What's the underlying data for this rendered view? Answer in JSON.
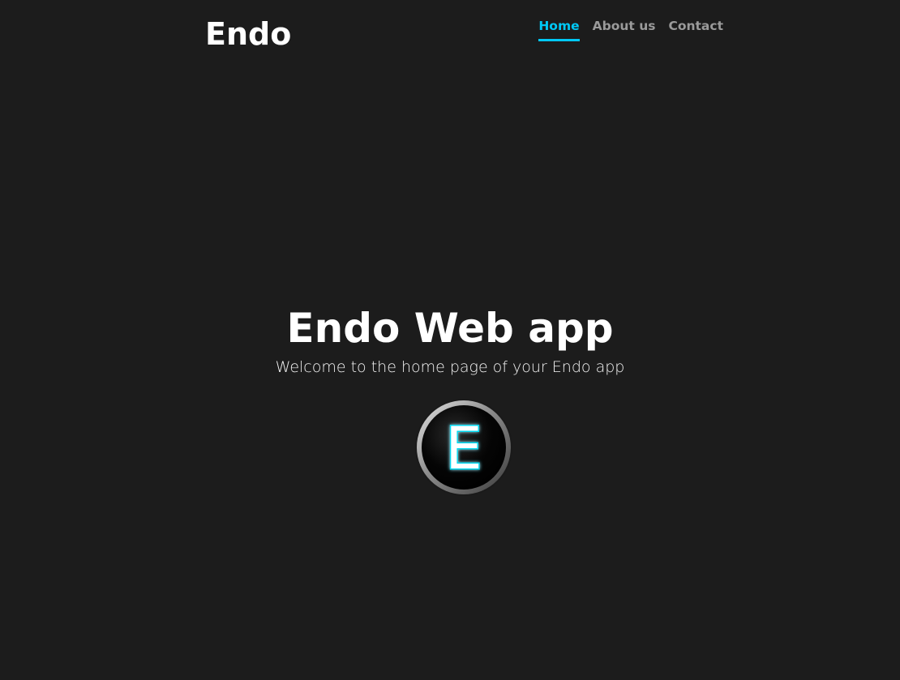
{
  "header": {
    "brand": "Endo",
    "nav": [
      {
        "label": "Home",
        "active": true
      },
      {
        "label": "About us",
        "active": false
      },
      {
        "label": "Contact",
        "active": false
      }
    ]
  },
  "hero": {
    "title": "Endo Web app",
    "subtitle": "Welcome to the home page of your Endo app",
    "logo_letter": "E"
  },
  "colors": {
    "background": "#1c1c1c",
    "accent": "#00c8f5",
    "nav_inactive": "#9a9a9a"
  }
}
